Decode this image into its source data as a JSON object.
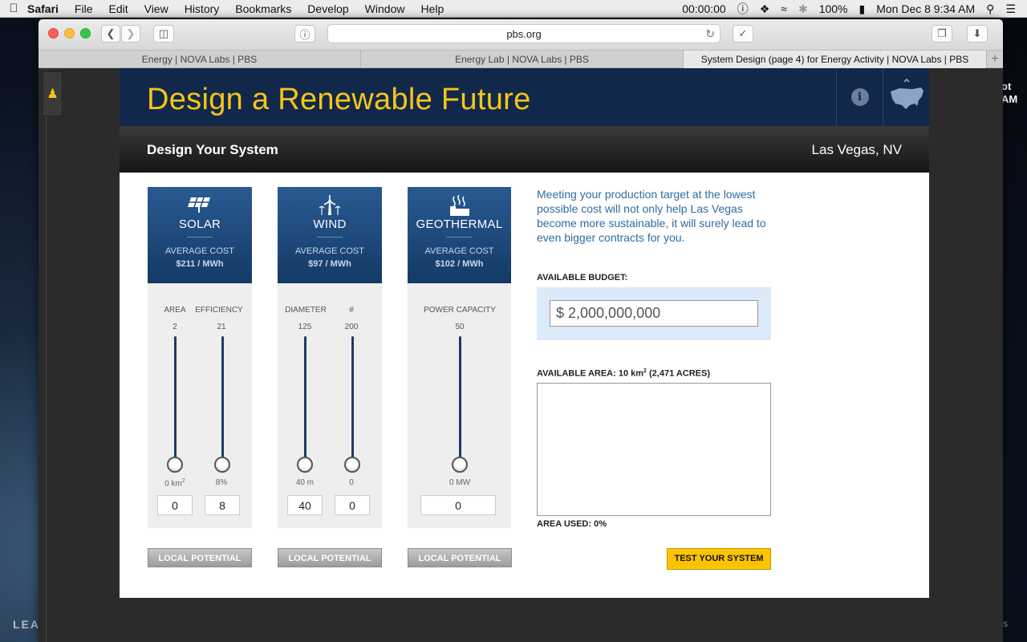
{
  "menubar": {
    "app": "Safari",
    "items": [
      "File",
      "Edit",
      "View",
      "History",
      "Bookmarks",
      "Develop",
      "Window",
      "Help"
    ],
    "timer": "00:00:00",
    "battery": "100%",
    "clock": "Mon Dec 8  9:34 AM"
  },
  "browser": {
    "url": "pbs.org",
    "tabs": [
      {
        "label": "Energy | NOVA Labs | PBS"
      },
      {
        "label": "Energy Lab | NOVA Labs | PBS"
      },
      {
        "label": "System Design (page 4) for Energy Activity | NOVA Labs | PBS"
      }
    ],
    "new_tab": "+"
  },
  "desktop": {
    "right_text_1": "ot",
    "right_text_2": "AM",
    "left_text": "LEA",
    "right_bottom": "s"
  },
  "page": {
    "title": "Design a Renewable Future",
    "info_icon": "i",
    "section": "Design Your System",
    "location": "Las Vegas, NV",
    "columns": [
      {
        "name": "SOLAR",
        "icon": "solar-panel-icon",
        "avg_label": "AVERAGE COST",
        "cost": "$211 / MWh",
        "sliders": [
          {
            "label": "AREA",
            "max": "2",
            "min": "0 km",
            "min_sup": "2",
            "value": "0",
            "level": 0
          },
          {
            "label": "EFFICIENCY",
            "max": "21",
            "min": "8%",
            "min_sup": "",
            "value": "8",
            "level": 0
          }
        ],
        "potential": "LOCAL POTENTIAL"
      },
      {
        "name": "WIND",
        "icon": "wind-turbine-icon",
        "avg_label": "AVERAGE COST",
        "cost": "$97 / MWh",
        "sliders": [
          {
            "label": "DIAMETER",
            "max": "125",
            "min": "40 m",
            "min_sup": "",
            "value": "40",
            "level": 0
          },
          {
            "label": "#",
            "max": "200",
            "min": "0",
            "min_sup": "",
            "value": "0",
            "level": 0
          }
        ],
        "potential": "LOCAL POTENTIAL"
      },
      {
        "name": "GEOTHERMAL",
        "icon": "geothermal-plant-icon",
        "avg_label": "AVERAGE COST",
        "cost": "$102 / MWh",
        "sliders": [
          {
            "label": "POWER CAPACITY",
            "max": "50",
            "min": "0 MW",
            "min_sup": "",
            "value": "0",
            "level": 0
          }
        ],
        "potential": "LOCAL POTENTIAL"
      }
    ],
    "intro": "Meeting your production target at the lowest possible cost will not only help Las Vegas become more sustainable, it will surely lead to even bigger contracts for you.",
    "budget_label": "AVAILABLE BUDGET:",
    "budget_value": "$ 2,000,000,000",
    "area_label_a": "AVAILABLE AREA: 10 km",
    "area_label_sup": "2",
    "area_label_b": " (2,471 ACRES)",
    "area_used": "AREA USED: 0%",
    "test_button": "TEST YOUR SYSTEM"
  }
}
